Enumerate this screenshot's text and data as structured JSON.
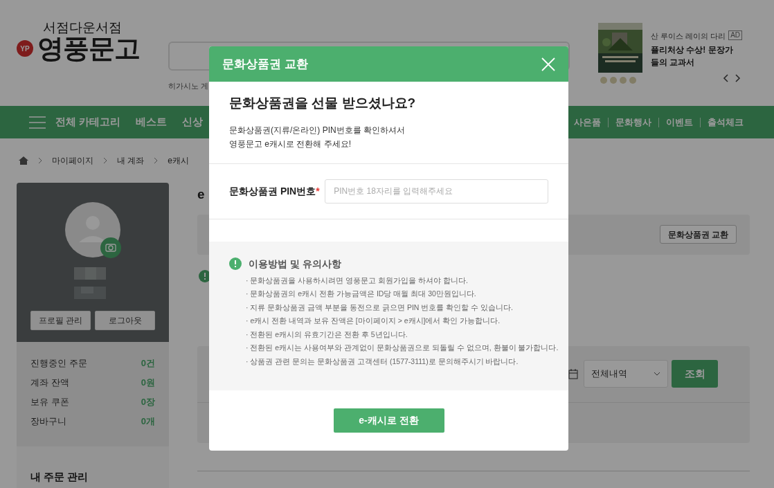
{
  "header": {
    "tagline": "서점다운서점",
    "logo_badge": "YP",
    "logo_text": "영풍문고",
    "search_hint": "히가시노 게",
    "ad": {
      "badge": "AD",
      "subtitle": "산 루이스 레이의 다리",
      "headline": "퓰리처상 수상! 문장가들의 교과서"
    }
  },
  "nav": {
    "left": [
      "전체 카테고리",
      "베스트",
      "신상"
    ],
    "right": [
      "사은품",
      "문화행사",
      "이벤트",
      "출석체크"
    ]
  },
  "breadcrumb": [
    "마이페이지",
    "내 계좌",
    "e캐시"
  ],
  "profile": {
    "buttons": [
      "프로필 관리",
      "로그아웃"
    ],
    "stats": [
      {
        "label": "진행중인 주문",
        "value": "0건"
      },
      {
        "label": "계좌 잔액",
        "value": "0원"
      },
      {
        "label": "보유 쿠폰",
        "value": "0장"
      },
      {
        "label": "장바구니",
        "value": "0개"
      }
    ],
    "section_title": "내 주문 관리"
  },
  "content": {
    "title": "e",
    "exchange_button": "문화상품권 교환",
    "filter": "전체내역",
    "search_button": "조회"
  },
  "modal": {
    "title": "문화상품권 교환",
    "heading": "문화상품권을 선물 받으셨나요?",
    "description": [
      "문화상품권(지류/온라인) PIN번호를 확인하셔서",
      "영풍문고 e캐시로 전환해 주세요!"
    ],
    "pin_label": "문화상품권 PIN번호",
    "required_mark": "*",
    "pin_placeholder": "PIN번호 18자리를 입력해주세요",
    "notice_title": "이용방법 및 유의사항",
    "notices": [
      "· 문화상품권을 사용하시려면 영풍문고 회원가입을 하셔야 합니다.",
      "· 문화상품권의 e캐시 전환 가능금액은 ID당 매월 최대 30만원입니다.",
      "· 지류 문화상품권 금액 부분을 동전으로 긁으면 PIN 번호를 확인할 수 있습니다.",
      "· e캐시 전환 내역과 보유 잔액은 [마이페이지 > e캐시]에서 확인 가능합니다.",
      "· 전환된 e캐시의 유효기간은 전환 후 5년입니다.",
      "· 전환된 e캐시는 사용여부와 관계없이 문화상품권으로 되돌릴 수 없으며, 환불이 불가합니다.",
      "· 상품권 관련 문의는 문화상품권 고객센터 (1577-3111)로 문의해주시기 바랍니다."
    ],
    "submit": "e-캐시로 전환"
  }
}
